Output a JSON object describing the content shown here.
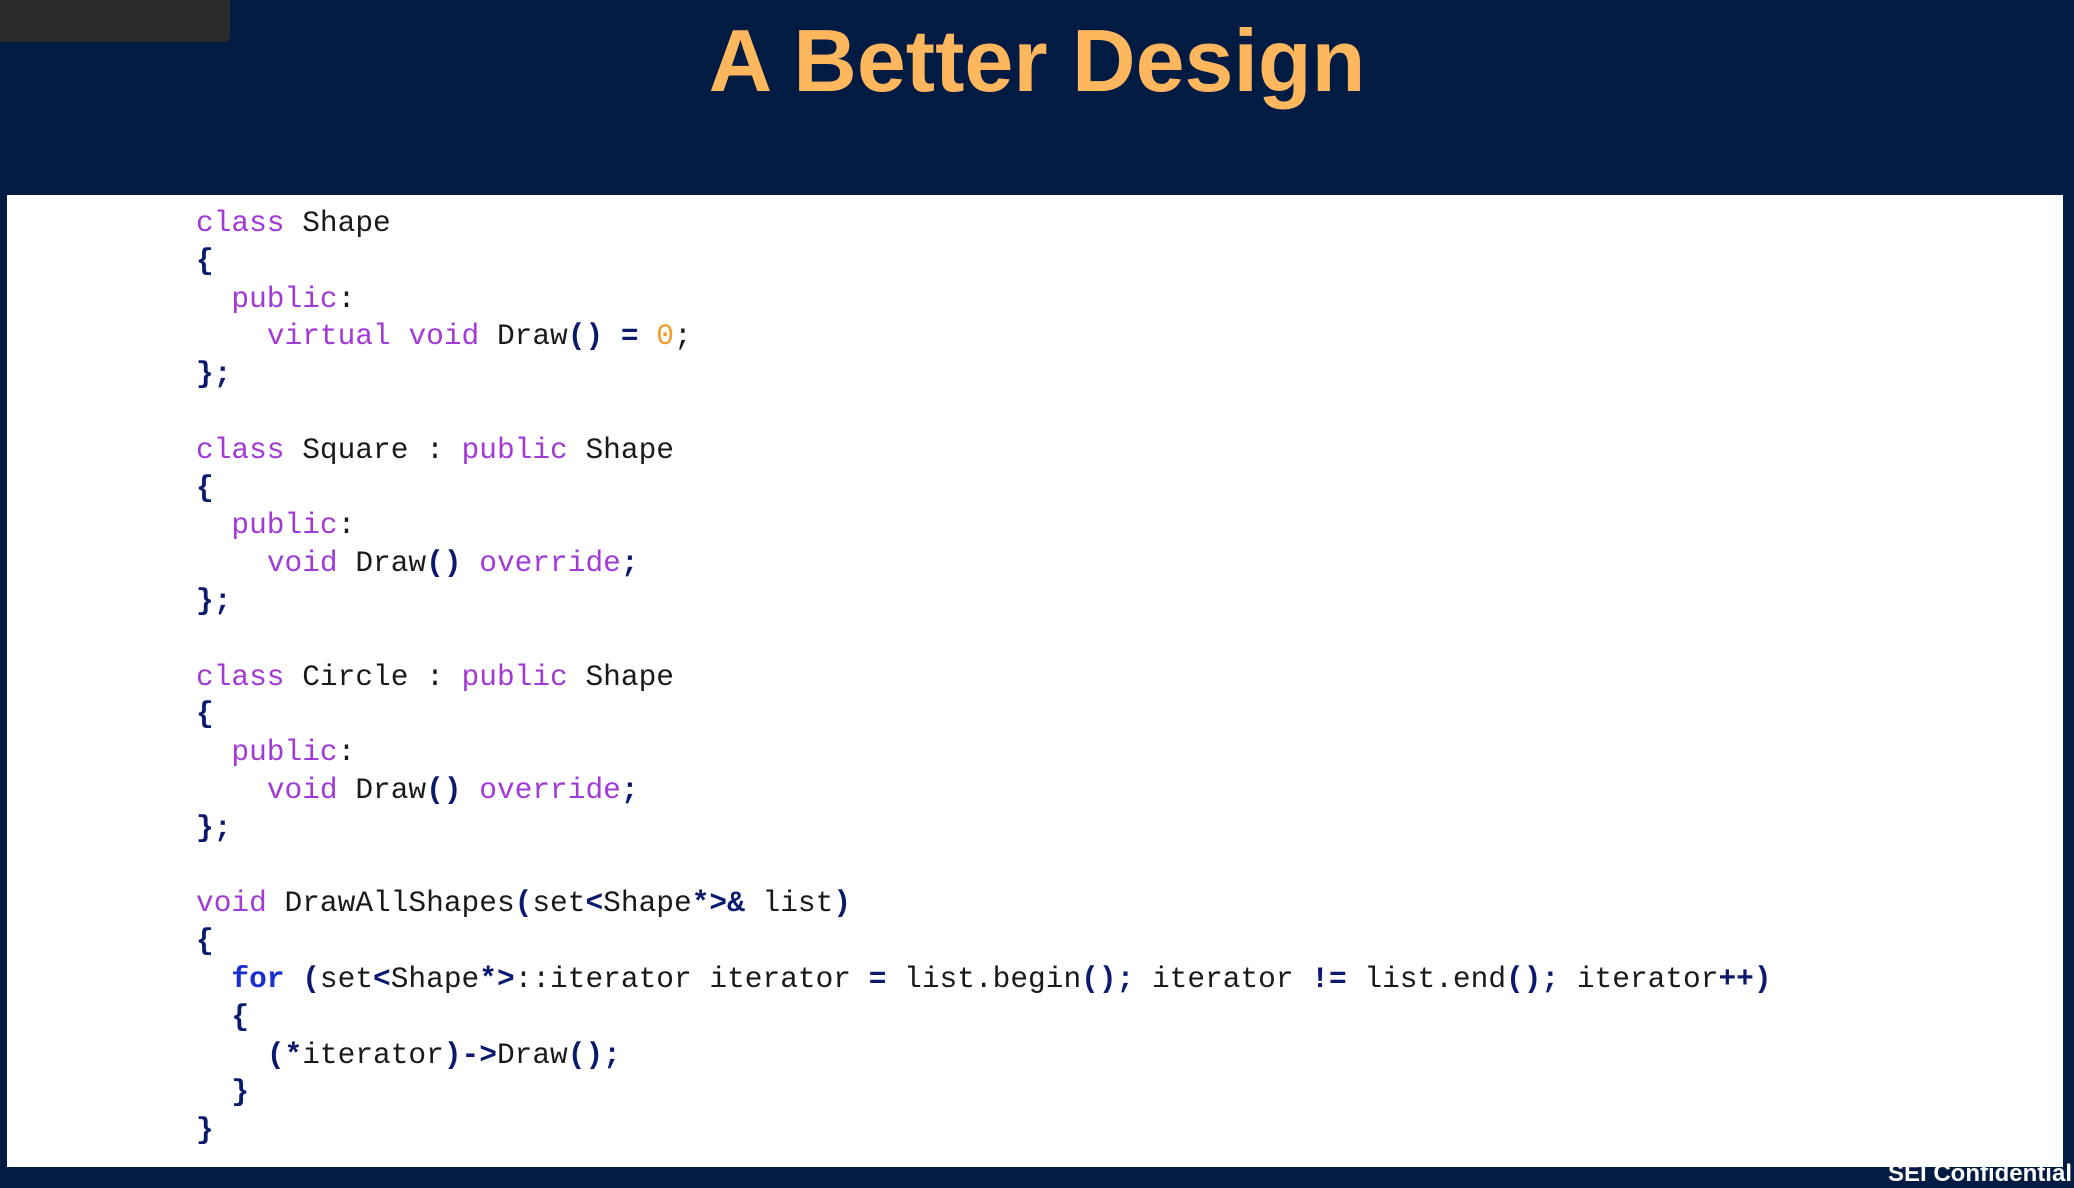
{
  "slide": {
    "title": "A Better Design",
    "footer": "SEI Confidential"
  },
  "colors": {
    "background": "#011b43",
    "title": "#ffb75e",
    "keyword": "#a13ad6",
    "number": "#f29d2a",
    "punctuation": "#0c1a6e",
    "control": "#1a2fcf"
  },
  "code": {
    "lines": [
      [
        [
          "kw",
          "class"
        ],
        [
          "tx",
          " Shape"
        ]
      ],
      [
        [
          "p",
          "{"
        ]
      ],
      [
        [
          "tx",
          "  "
        ],
        [
          "kw",
          "public"
        ],
        [
          "tx",
          ":"
        ]
      ],
      [
        [
          "tx",
          "    "
        ],
        [
          "kw",
          "virtual"
        ],
        [
          "tx",
          " "
        ],
        [
          "kw",
          "void"
        ],
        [
          "tx",
          " Draw"
        ],
        [
          "p",
          "()"
        ],
        [
          "tx",
          " "
        ],
        [
          "p",
          "="
        ],
        [
          "tx",
          " "
        ],
        [
          "num",
          "0"
        ],
        [
          "tx",
          ";"
        ]
      ],
      [
        [
          "p",
          "};"
        ]
      ],
      [],
      [
        [
          "kw",
          "class"
        ],
        [
          "tx",
          " Square : "
        ],
        [
          "kw",
          "public"
        ],
        [
          "tx",
          " Shape"
        ]
      ],
      [
        [
          "p",
          "{"
        ]
      ],
      [
        [
          "tx",
          "  "
        ],
        [
          "kw",
          "public"
        ],
        [
          "tx",
          ":"
        ]
      ],
      [
        [
          "tx",
          "    "
        ],
        [
          "kw",
          "void"
        ],
        [
          "tx",
          " Draw"
        ],
        [
          "p",
          "()"
        ],
        [
          "tx",
          " "
        ],
        [
          "kw",
          "override"
        ],
        [
          "p",
          ";"
        ]
      ],
      [
        [
          "p",
          "};"
        ]
      ],
      [],
      [
        [
          "kw",
          "class"
        ],
        [
          "tx",
          " Circle : "
        ],
        [
          "kw",
          "public"
        ],
        [
          "tx",
          " Shape"
        ]
      ],
      [
        [
          "p",
          "{"
        ]
      ],
      [
        [
          "tx",
          "  "
        ],
        [
          "kw",
          "public"
        ],
        [
          "tx",
          ":"
        ]
      ],
      [
        [
          "tx",
          "    "
        ],
        [
          "kw",
          "void"
        ],
        [
          "tx",
          " Draw"
        ],
        [
          "p",
          "()"
        ],
        [
          "tx",
          " "
        ],
        [
          "kw",
          "override"
        ],
        [
          "p",
          ";"
        ]
      ],
      [
        [
          "p",
          "};"
        ]
      ],
      [],
      [
        [
          "kw",
          "void"
        ],
        [
          "tx",
          " DrawAllShapes"
        ],
        [
          "p",
          "("
        ],
        [
          "tx",
          "set"
        ],
        [
          "p",
          "<"
        ],
        [
          "tx",
          "Shape"
        ],
        [
          "p",
          "*>&"
        ],
        [
          "tx",
          " list"
        ],
        [
          "p",
          ")"
        ]
      ],
      [
        [
          "p",
          "{"
        ]
      ],
      [
        [
          "tx",
          "  "
        ],
        [
          "ctl",
          "for"
        ],
        [
          "tx",
          " "
        ],
        [
          "p",
          "("
        ],
        [
          "tx",
          "set"
        ],
        [
          "p",
          "<"
        ],
        [
          "tx",
          "Shape"
        ],
        [
          "p",
          "*>"
        ],
        [
          "tx",
          "::iterator iterator "
        ],
        [
          "p",
          "="
        ],
        [
          "tx",
          " list.begin"
        ],
        [
          "p",
          "();"
        ],
        [
          "tx",
          " iterator "
        ],
        [
          "p",
          "!="
        ],
        [
          "tx",
          " list.end"
        ],
        [
          "p",
          "();"
        ],
        [
          "tx",
          " iterator"
        ],
        [
          "p",
          "++)"
        ]
      ],
      [
        [
          "tx",
          "  "
        ],
        [
          "p",
          "{"
        ]
      ],
      [
        [
          "tx",
          "    "
        ],
        [
          "p",
          "(*"
        ],
        [
          "tx",
          "iterator"
        ],
        [
          "p",
          ")->"
        ],
        [
          "tx",
          "Draw"
        ],
        [
          "p",
          "();"
        ]
      ],
      [
        [
          "tx",
          "  "
        ],
        [
          "p",
          "}"
        ]
      ],
      [
        [
          "p",
          "}"
        ]
      ]
    ]
  }
}
